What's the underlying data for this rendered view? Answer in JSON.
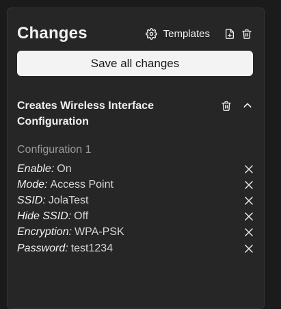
{
  "header": {
    "title": "Changes",
    "templates_label": "Templates"
  },
  "save_all_label": "Save all changes",
  "change": {
    "title": "Creates Wireless Interface Configuration",
    "configuration_name": "Configuration 1",
    "properties": [
      {
        "key": "Enable:",
        "value": "On"
      },
      {
        "key": "Mode:",
        "value": "Access Point"
      },
      {
        "key": "SSID:",
        "value": "JolaTest"
      },
      {
        "key": "Hide SSID:",
        "value": "Off"
      },
      {
        "key": "Encryption:",
        "value": "WPA-PSK"
      },
      {
        "key": "Password:",
        "value": "test1234"
      }
    ]
  },
  "icons": {
    "templates": "gear-icon",
    "new_file": "file-plus-icon",
    "delete_all": "trash-icon",
    "delete_change": "trash-icon",
    "collapse": "chevron-up-icon",
    "remove_property": "close-icon"
  },
  "colors": {
    "background": "#1b1b1b",
    "panel": "#262626",
    "save_button": "#f3f3f3",
    "muted_text": "#9a9a9a"
  }
}
